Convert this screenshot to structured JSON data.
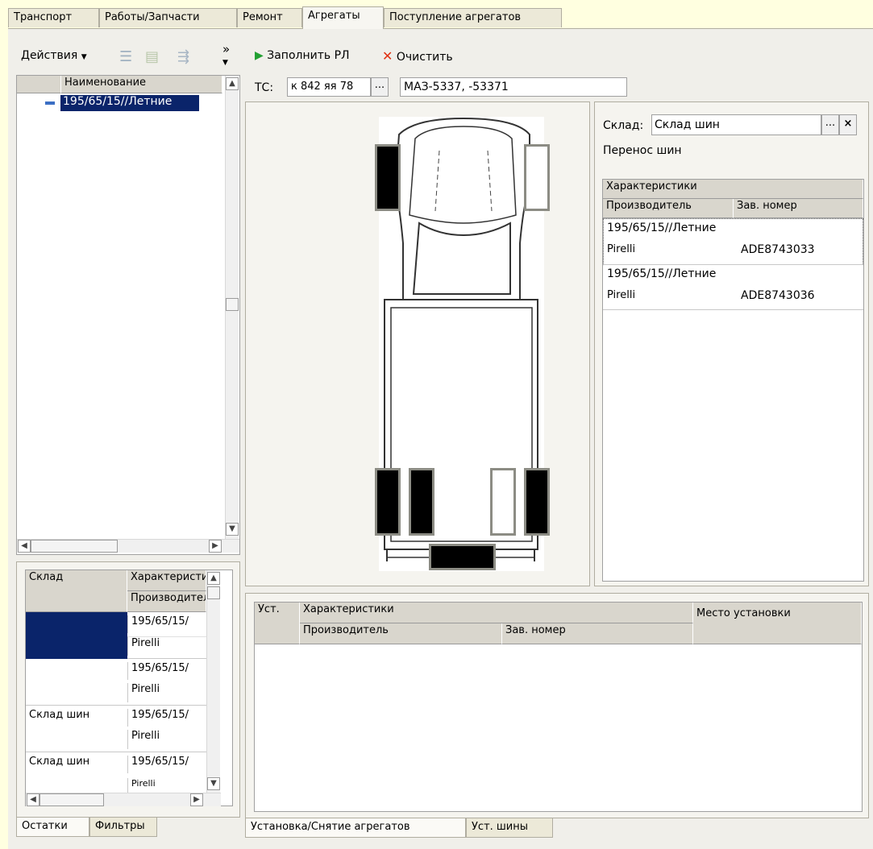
{
  "tabs": [
    "Транспорт",
    "Работы/Запчасти",
    "Ремонт",
    "Агрегаты",
    "Поступление агрегатов"
  ],
  "left_toolbar": {
    "actions": "Действия",
    "more": "»"
  },
  "right_toolbar": {
    "fill": "Заполнить РЛ",
    "clear": "Очистить"
  },
  "tree": {
    "header": "Наименование",
    "items": [
      {
        "label": "195/65/15//Летние"
      }
    ]
  },
  "vehicle": {
    "label": "ТС:",
    "plate": "к 842 яя 78",
    "ellipsis": "...",
    "model": "МАЗ-5337, -53371"
  },
  "warehouse": {
    "label": "Склад:",
    "value": "Склад шин",
    "ellipsis": "...",
    "clear": "×",
    "subtitle": "Перенос шин"
  },
  "right_table": {
    "group_header": "Характеристики",
    "col1": "Производитель",
    "col2": "Зав. номер",
    "rows": [
      {
        "name": "195/65/15//Летние",
        "maker": "Pirelli",
        "serial": "ADE8743033"
      },
      {
        "name": "195/65/15//Летние",
        "maker": "Pirelli",
        "serial": "ADE8743036"
      }
    ]
  },
  "stock_table": {
    "col1": "Склад",
    "col2": "Характеристики",
    "col2_sub": "Производитель",
    "rows": [
      {
        "store": "",
        "name": "195/65/15/",
        "maker": "Pirelli"
      },
      {
        "store": "",
        "name": "195/65/15/",
        "maker": "Pirelli"
      },
      {
        "store": "Склад шин",
        "name": "195/65/15/",
        "maker": "Pirelli"
      },
      {
        "store": "Склад шин",
        "name": "195/65/15/",
        "maker": "Pirelli"
      }
    ]
  },
  "install_table": {
    "col_inst": "Уст.",
    "col_chars": "Характеристики",
    "col_maker": "Производитель",
    "col_serial": "Зав. номер",
    "col_place": "Место установки"
  },
  "bottom_tabs_left": [
    "Остатки",
    "Фильтры"
  ],
  "bottom_tabs_right": [
    "Установка/Снятие агрегатов",
    "Уст. шины"
  ],
  "colors": {
    "selection": "#0a246a",
    "accent_green": "#22a032",
    "accent_red": "#e03010"
  }
}
